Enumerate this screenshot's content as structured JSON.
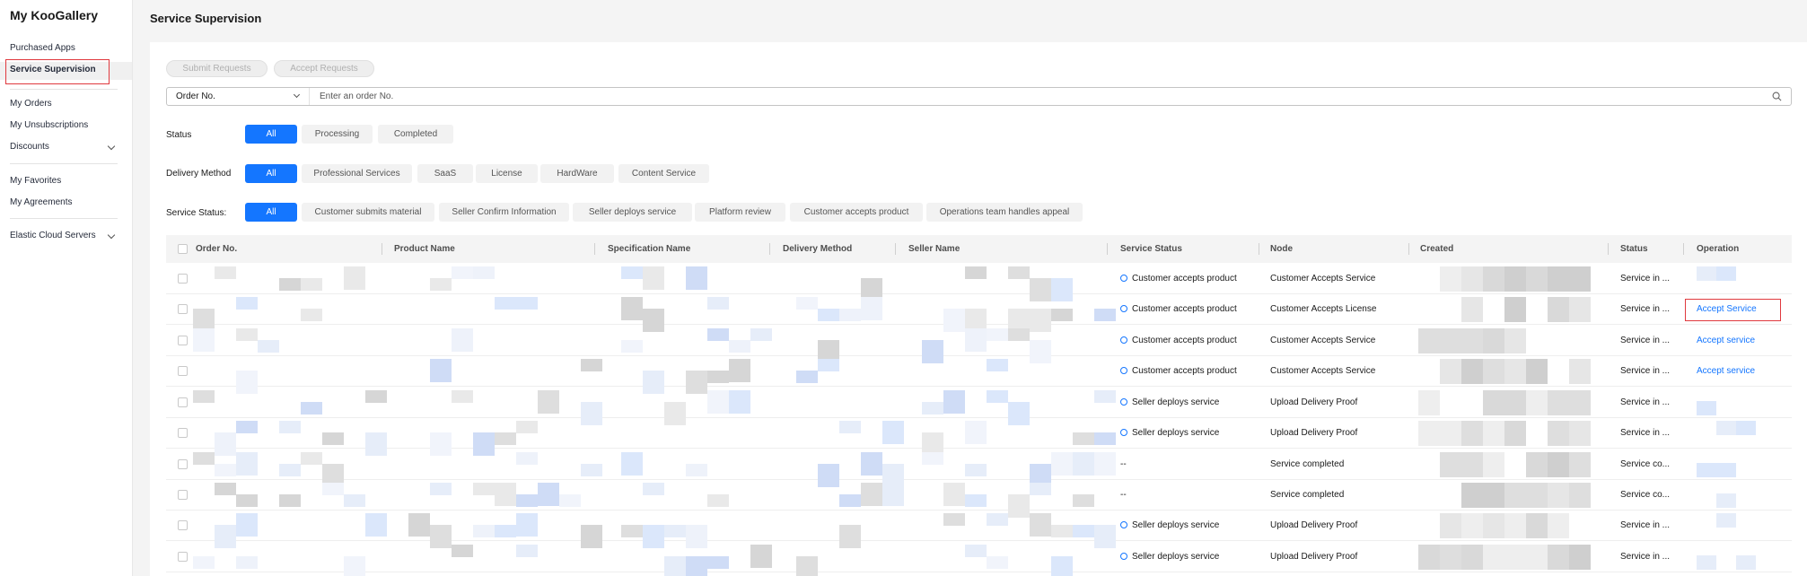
{
  "sidebar": {
    "title": "My KooGallery",
    "items": [
      {
        "label": "Purchased Apps",
        "active": false
      },
      {
        "label": "Service Supervision",
        "active": true
      },
      {
        "label": "My Orders",
        "active": false
      },
      {
        "label": "My Unsubscriptions",
        "active": false
      },
      {
        "label": "Discounts",
        "active": false,
        "expandable": true
      },
      {
        "label": "My Favorites",
        "active": false
      },
      {
        "label": "My Agreements",
        "active": false
      },
      {
        "label": "Elastic Cloud Servers",
        "active": false,
        "expandable": true
      }
    ]
  },
  "header": {
    "title": "Service Supervision"
  },
  "toolbar": {
    "submit_label": "Submit Requests",
    "accept_label": "Accept Requests"
  },
  "search": {
    "select_value": "Order No.",
    "placeholder": "Enter an order No.",
    "value": ""
  },
  "filters": {
    "status": {
      "label": "Status",
      "options": [
        "All",
        "Processing",
        "Completed"
      ],
      "selected": "All"
    },
    "delivery": {
      "label": "Delivery Method",
      "options": [
        "All",
        "Professional Services",
        "SaaS",
        "License",
        "HardWare",
        "Content Service"
      ],
      "selected": "All"
    },
    "service_status": {
      "label": "Service Status:",
      "options": [
        "All",
        "Customer submits material",
        "Seller Confirm Information",
        "Seller deploys service",
        "Platform review",
        "Customer accepts product",
        "Operations team handles appeal"
      ],
      "selected": "All"
    }
  },
  "table": {
    "columns": [
      "Order No.",
      "Product Name",
      "Specification Name",
      "Delivery Method",
      "Seller Name",
      "Service Status",
      "Node",
      "Created",
      "Status",
      "Operation"
    ],
    "rows": [
      {
        "service_status": "Customer accepts product",
        "has_dot": true,
        "node": "Customer Accepts Service",
        "status": "Service in ...",
        "operation": ""
      },
      {
        "service_status": "Customer accepts product",
        "has_dot": true,
        "node": "Customer Accepts License",
        "status": "Service in ...",
        "operation": "Accept Service"
      },
      {
        "service_status": "Customer accepts product",
        "has_dot": true,
        "node": "Customer Accepts Service",
        "status": "Service in ...",
        "operation": "Accept service"
      },
      {
        "service_status": "Customer accepts product",
        "has_dot": true,
        "node": "Customer Accepts Service",
        "status": "Service in ...",
        "operation": "Accept service"
      },
      {
        "service_status": "Seller deploys service",
        "has_dot": true,
        "node": "Upload Delivery Proof",
        "status": "Service in ...",
        "operation": ""
      },
      {
        "service_status": "Seller deploys service",
        "has_dot": true,
        "node": "Upload Delivery Proof",
        "status": "Service in ...",
        "operation": ""
      },
      {
        "service_status": "--",
        "has_dot": false,
        "node": "Service completed",
        "status": "Service co...",
        "operation": ""
      },
      {
        "service_status": "--",
        "has_dot": false,
        "node": "Service completed",
        "status": "Service co...",
        "operation": ""
      },
      {
        "service_status": "Seller deploys service",
        "has_dot": true,
        "node": "Upload Delivery Proof",
        "status": "Service in ...",
        "operation": ""
      },
      {
        "service_status": "Seller deploys service",
        "has_dot": true,
        "node": "Upload Delivery Proof",
        "status": "Service in ...",
        "operation": ""
      }
    ]
  },
  "colors": {
    "accent": "#1476ff",
    "highlight": "#e0393e"
  }
}
